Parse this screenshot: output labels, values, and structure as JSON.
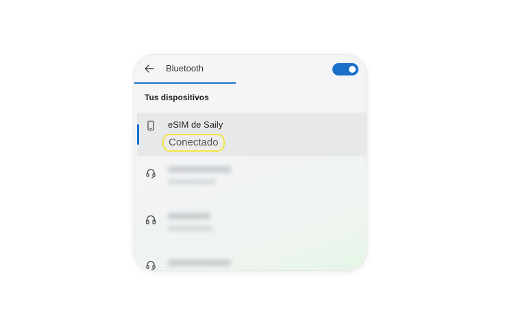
{
  "header": {
    "back_icon": "arrow-left-icon",
    "title": "Bluetooth",
    "toggle": {
      "state": "on",
      "color": "#1a6fc9"
    }
  },
  "section": {
    "title": "Tus dispositivos"
  },
  "devices": [
    {
      "icon": "phone-icon",
      "name": "eSIM de Saily",
      "status": "Conectado",
      "selected": true
    },
    {
      "icon": "headset-icon",
      "name": "",
      "status": "",
      "blurred": true
    },
    {
      "icon": "headphones-icon",
      "name": "",
      "status": "",
      "blurred": true
    },
    {
      "icon": "headset-icon",
      "name": "",
      "status": "",
      "blurred": true
    }
  ],
  "colors": {
    "accent": "#1a6fc9",
    "highlight_outline": "#f3e53c"
  }
}
